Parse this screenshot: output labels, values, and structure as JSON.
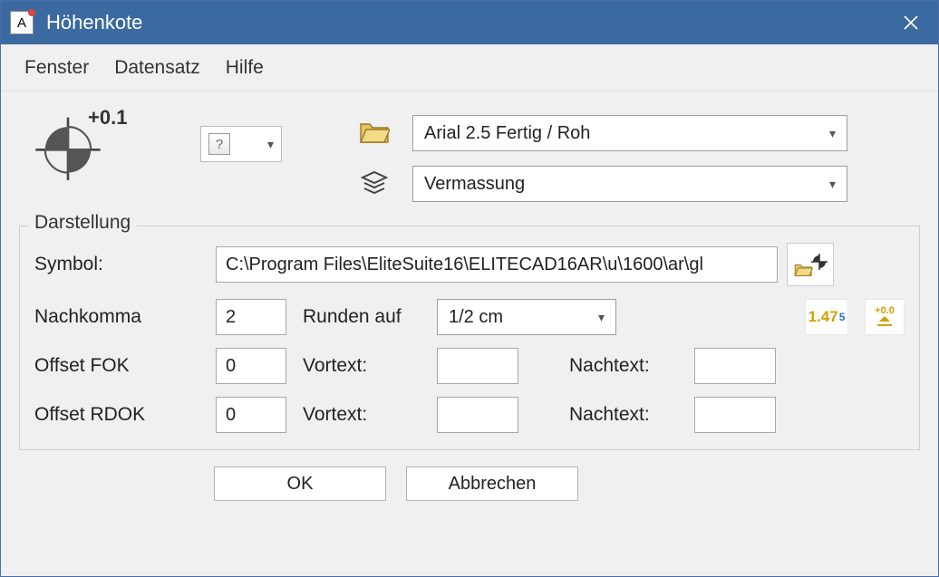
{
  "window": {
    "title": "Höhenkote"
  },
  "menu": {
    "items": [
      "Fenster",
      "Datensatz",
      "Hilfe"
    ]
  },
  "header": {
    "kote_label": "+0.1",
    "font_select": "Arial 2.5 Fertig / Roh",
    "layer_select": "Vermassung"
  },
  "group": {
    "title": "Darstellung",
    "labels": {
      "symbol": "Symbol:",
      "nachkomma": "Nachkomma",
      "runden_auf": "Runden auf",
      "offset_fok": "Offset FOK",
      "offset_rdok": "Offset RDOK",
      "vortext": "Vortext:",
      "nachtext": "Nachtext:"
    },
    "values": {
      "symbol_path": "C:\\Program Files\\EliteSuite16\\ELITECAD16AR\\u\\1600\\ar\\gl",
      "nachkomma": "2",
      "runden_auf": "1/2 cm",
      "offset_fok": "0",
      "offset_rdok": "0",
      "fok_vortext": "",
      "fok_nachtext": "",
      "rdok_vortext": "",
      "rdok_nachtext": ""
    },
    "badges": {
      "sample_value": "1.47",
      "sample_exp": "5",
      "zero_ref": "+0.0"
    }
  },
  "buttons": {
    "ok": "OK",
    "cancel": "Abbrechen"
  },
  "icons": {
    "app": "A"
  }
}
